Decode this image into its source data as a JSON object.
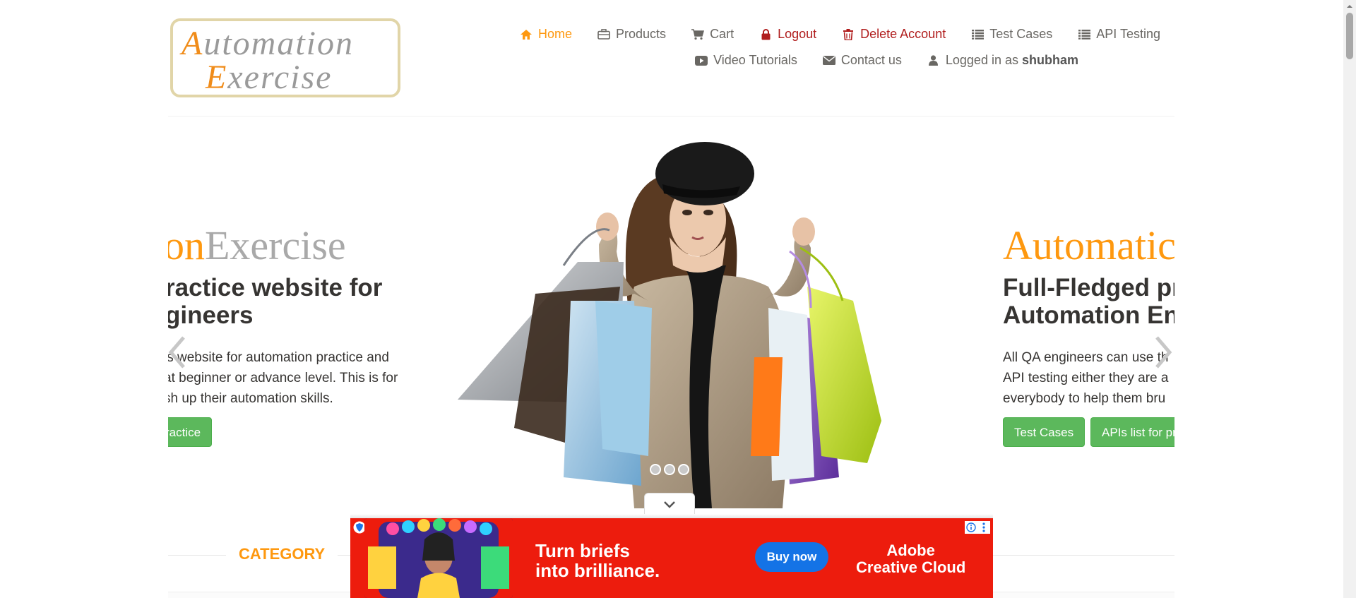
{
  "header": {
    "logo": {
      "line1_cap": "A",
      "line1_rest": "utomation",
      "line2_cap": "E",
      "line2_rest": "xercise"
    },
    "nav_row1": [
      {
        "label": "Home",
        "icon": "home-icon"
      },
      {
        "label": "Products",
        "icon": "briefcase-icon"
      },
      {
        "label": "Cart",
        "icon": "cart-icon"
      },
      {
        "label": "Logout",
        "icon": "lock-icon"
      },
      {
        "label": "Delete Account",
        "icon": "trash-icon"
      },
      {
        "label": "Test Cases",
        "icon": "list-icon"
      },
      {
        "label": "API Testing",
        "icon": "list-icon"
      }
    ],
    "nav_row2": [
      {
        "label": "Video Tutorials",
        "icon": "youtube-play-icon"
      },
      {
        "label": "Contact us",
        "icon": "envelope-icon"
      },
      {
        "label": "Logged in as",
        "icon": "user-icon",
        "username": "shubham"
      }
    ]
  },
  "slider": {
    "left_slide": {
      "title_orange": "on",
      "title_gray": "Exercise",
      "subtitle_line1": "ractice website for",
      "subtitle_line2": "gineers",
      "text_line1": "is website for automation practice and",
      "text_line2": "at beginner or advance level. This is for",
      "text_line3": "sh up their automation skills.",
      "button": "ractice"
    },
    "right_slide": {
      "title_orange": "Automatic",
      "subtitle_line1": "Full-Fledged pr",
      "subtitle_line2": "Automation En",
      "text_line1": "All QA engineers can use th",
      "text_line2": "API testing either they are a",
      "text_line3": "everybody to help them bru",
      "button_test_cases": "Test Cases",
      "button_apis": "APIs list for pr"
    }
  },
  "category": {
    "title": "CATEGORY"
  },
  "ad": {
    "headline_line1": "Turn briefs",
    "headline_line2": "into brilliance.",
    "button": "Buy now",
    "brand_line1": "Adobe",
    "brand_line2": "Creative Cloud",
    "colors": {
      "background": "#ed1c0d",
      "button": "#1473e6"
    }
  },
  "colors": {
    "accent": "#fe980f",
    "danger": "#b01c1c",
    "green": "#5cb85c",
    "text": "#696763"
  }
}
